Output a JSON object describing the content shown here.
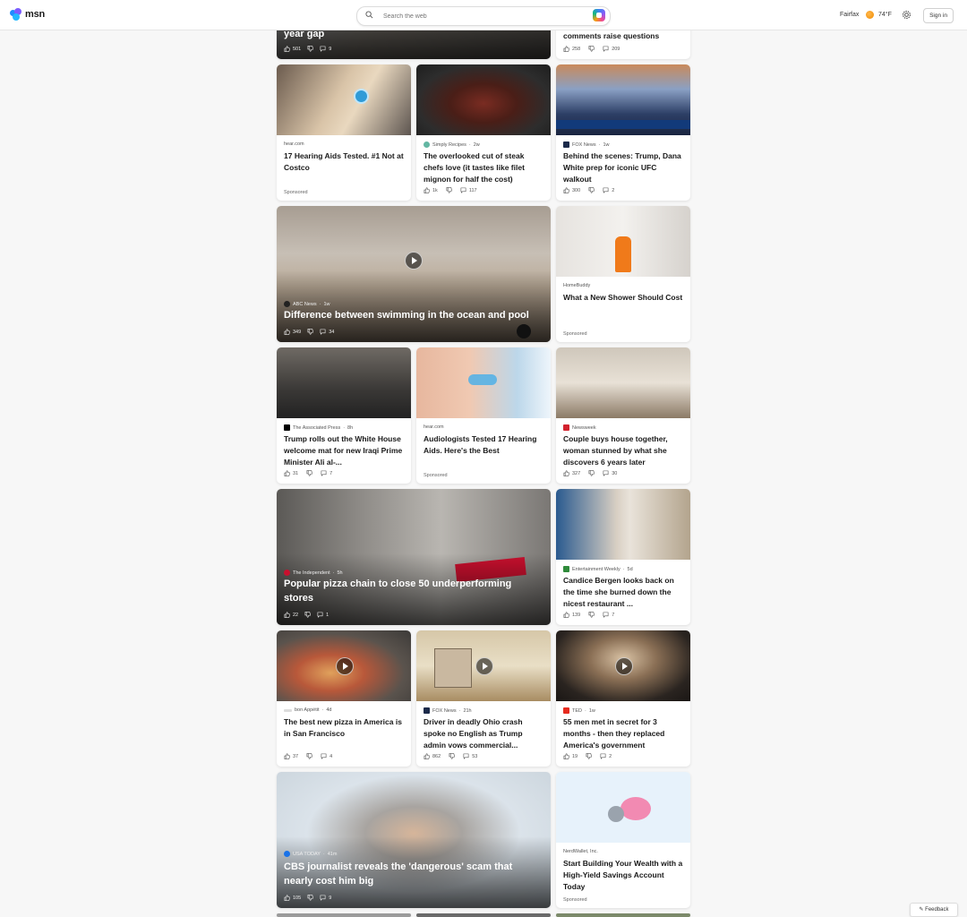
{
  "header": {
    "logo_text": "msn",
    "search_placeholder": "Search the web",
    "location": "Fairfax",
    "temperature": "74°F",
    "signin_label": "Sign in"
  },
  "cards": {
    "c0": {
      "title": "year gap",
      "likes": "501",
      "comments": "9"
    },
    "c1": {
      "title": "comments raise questions",
      "likes": "258",
      "comments": "209"
    },
    "c2": {
      "source": "hear.com",
      "title": "17 Hearing Aids Tested. #1 Not at Costco",
      "sponsored": "Sponsored"
    },
    "c3": {
      "source": "Simply Recipes",
      "age": "2w",
      "title": "The overlooked cut of steak chefs love (it tastes like filet mignon for half the cost)",
      "likes": "1k",
      "comments": "117"
    },
    "c4": {
      "source": "FOX News",
      "age": "1w",
      "title": "Behind the scenes: Trump, Dana White prep for iconic UFC walkout",
      "likes": "300",
      "comments": "2"
    },
    "c5": {
      "source": "ABC News",
      "age": "1w",
      "title": "Difference between swimming in the ocean and pool",
      "likes": "349",
      "comments": "34"
    },
    "c6": {
      "source": "HomeBuddy",
      "title": "What a New Shower Should Cost",
      "sponsored": "Sponsored"
    },
    "c7": {
      "source": "The Associated Press",
      "age": "8h",
      "title": "Trump rolls out the White House welcome mat for new Iraqi Prime Minister Ali al-...",
      "likes": "31",
      "comments": "7"
    },
    "c8": {
      "source": "hear.com",
      "title": "Audiologists Tested 17 Hearing Aids. Here's the Best",
      "sponsored": "Sponsored"
    },
    "c9": {
      "source": "Newsweek",
      "title": "Couple buys house together, woman stunned by what she discovers 6 years later",
      "likes": "327",
      "comments": "30"
    },
    "c10": {
      "source": "The Independent",
      "age": "5h",
      "title": "Popular pizza chain to close 50 underperforming stores",
      "likes": "22",
      "comments": "1"
    },
    "c11": {
      "source": "Entertainment Weekly",
      "age": "5d",
      "title": "Candice Bergen looks back on the time she burned down the nicest restaurant ...",
      "likes": "139",
      "comments": "7"
    },
    "c12": {
      "source": "bon Appétit",
      "age": "4d",
      "title": "The best new pizza in America is in San Francisco",
      "likes": "37",
      "comments": "4"
    },
    "c13": {
      "source": "FOX News",
      "age": "21h",
      "title": "Driver in deadly Ohio crash spoke no English as Trump admin vows commercial...",
      "likes": "862",
      "comments": "53"
    },
    "c14": {
      "source": "TED",
      "age": "1w",
      "title": "55 men met in secret for 3 months - then they replaced America's government",
      "likes": "19",
      "comments": "2"
    },
    "c15": {
      "source": "USA TODAY",
      "age": "41m",
      "title": "CBS journalist reveals the 'dangerous' scam that nearly cost him big",
      "likes": "105",
      "comments": "9"
    },
    "c16": {
      "source": "NerdWallet, Inc.",
      "title": "Start Building Your Wealth with a High-Yield Savings Account Today",
      "sponsored": "Sponsored"
    }
  },
  "feedback_label": "Feedback",
  "colors": {
    "accent": "#0f6cbd",
    "background": "#f7f7f7"
  }
}
